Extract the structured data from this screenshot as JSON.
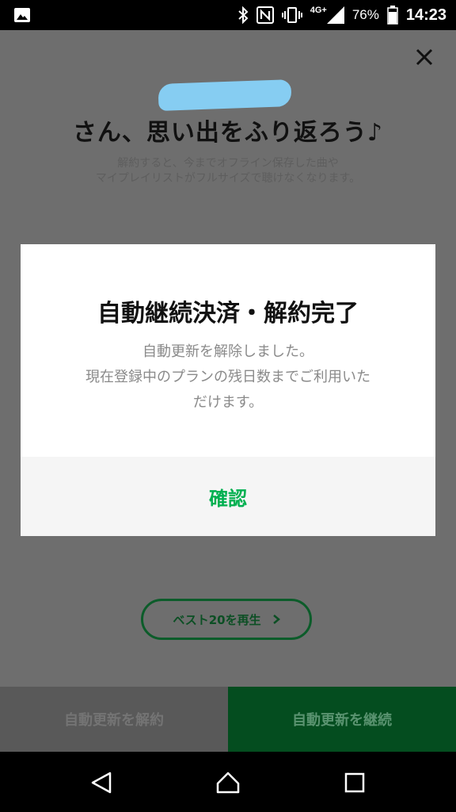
{
  "status_bar": {
    "network": "4G+",
    "battery": "76%",
    "time": "14:23"
  },
  "background": {
    "headline": "さん、思い出をふり返ろう♪",
    "subtext_line1": "解約すると、今までオフライン保存した曲や",
    "subtext_line2": "マイプレイリストがフルサイズで聴けなくなります。",
    "best_button_label": "ベスト20を再生",
    "cancel_button_label": "自動更新を解約",
    "continue_button_label": "自動更新を継続"
  },
  "dialog": {
    "title": "自動継続決済・解約完了",
    "body_line1": "自動更新を解除しました。",
    "body_line2": "現在登録中のプランの残日数までご利用いた",
    "body_line3": "だけます。",
    "confirm_label": "確認"
  },
  "colors": {
    "accent_green": "#00b050",
    "dark_green": "#044d1f",
    "name_blur": "#86cdf2"
  },
  "icons": {
    "status_left": "image-icon",
    "status_right": [
      "bluetooth-icon",
      "nfc-icon",
      "vibrate-icon",
      "signal-icon",
      "battery-icon"
    ],
    "close": "close-icon",
    "best_button": "chevron-right-icon",
    "nav": [
      "back-icon",
      "home-icon",
      "recents-icon"
    ]
  }
}
